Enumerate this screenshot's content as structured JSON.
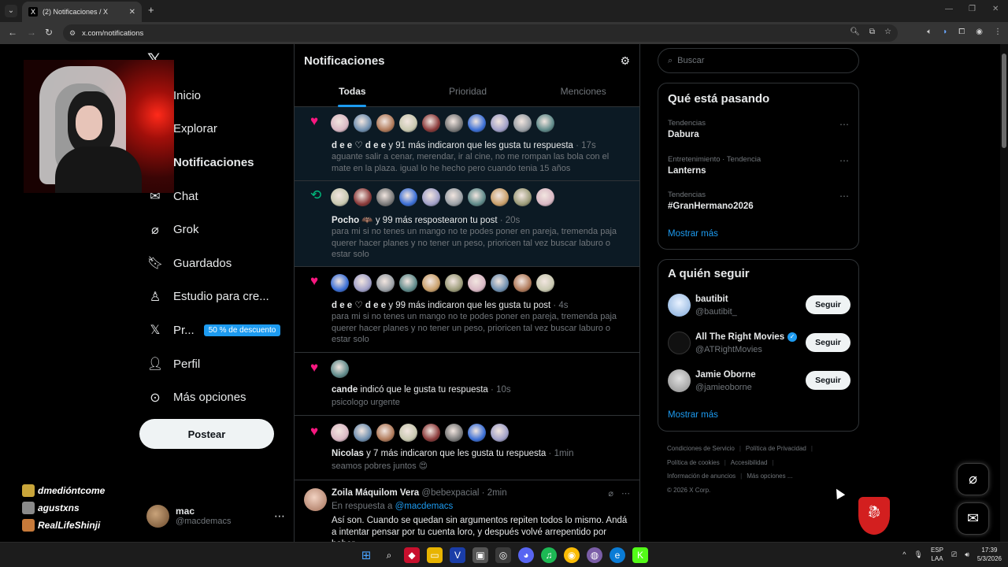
{
  "browser": {
    "tab_title": "(2) Notificaciones / X",
    "tab_favicon": "X",
    "url": "x.com/notifications"
  },
  "colors": {
    "accent": "#1d9bf0",
    "like": "#f91880",
    "retweet": "#00ba7c",
    "background": "#000000",
    "border": "#2f3336",
    "muted": "#71767b"
  },
  "nav": {
    "items": [
      {
        "label": "Inicio",
        "icon": "home-icon"
      },
      {
        "label": "Explorar",
        "icon": "search-icon"
      },
      {
        "label": "Notificaciones",
        "icon": "bell-icon"
      },
      {
        "label": "Chat",
        "icon": "mail-icon"
      },
      {
        "label": "Grok",
        "icon": "grok-icon"
      },
      {
        "label": "Guardados",
        "icon": "bookmark-icon"
      },
      {
        "label": "Estudio para cre...",
        "icon": "creator-studio-icon"
      },
      {
        "label": "Pr...",
        "icon": "x-logo-icon",
        "badge": "50 % de descuento"
      },
      {
        "label": "Perfil",
        "icon": "person-icon"
      },
      {
        "label": "Más opciones",
        "icon": "more-circle-icon"
      }
    ],
    "post_button": "Postear"
  },
  "account": {
    "name": "mac",
    "handle": "@macdemacs"
  },
  "viewers": [
    "dmedióntcome",
    "agustxns",
    "RealLifeShinji"
  ],
  "main": {
    "title": "Notificaciones",
    "tabs": [
      "Todas",
      "Prioridad",
      "Menciones"
    ],
    "active_tab": "Todas",
    "notifications": [
      {
        "kind": "like",
        "avatar_count": 10,
        "actor": "d e e ♡ d e e",
        "text": " y 91 más indicaron que les gusta tu respuesta",
        "time": " · 17s",
        "body": "aguante salir a cenar, merendar, ir al cine, no me rompan las bola con el mate en la plaza. igual lo he hecho pero cuando tenia 15 años",
        "highlighted": true
      },
      {
        "kind": "repost",
        "avatar_count": 10,
        "actor": "Pocho 🦇",
        "text": " y 99 más respostearon tu post",
        "time": " · 20s",
        "body": "para mi si no tenes un mango no te podes poner en pareja, tremenda paja querer hacer planes y no tener un peso, prioricen tal vez buscar laburo o estar solo",
        "highlighted": true
      },
      {
        "kind": "like",
        "avatar_count": 10,
        "actor": "d e e ♡ d e e",
        "text": " y 99 más indicaron que les gusta tu post",
        "time": " · 4s",
        "body": "para mi si no tenes un mango no te podes poner en pareja, tremenda paja querer hacer planes y no tener un peso, prioricen tal vez buscar laburo o estar solo",
        "highlighted": false
      },
      {
        "kind": "like",
        "avatar_count": 1,
        "actor": "cande",
        "text": " indicó que le gusta tu respuesta",
        "time": " · 10s",
        "body": "psicologo urgente",
        "highlighted": false
      },
      {
        "kind": "like",
        "avatar_count": 8,
        "actor": "Nicolas",
        "text": " y 7 más indicaron que les gusta tu respuesta",
        "time": " · 1min",
        "body": "seamos pobres juntos 😍",
        "highlighted": false
      }
    ],
    "reply_tweet": {
      "name": "Zoila Máquilom Vera",
      "handle": "@bebexpacial",
      "time": "· 2min",
      "reply_prefix": "En respuesta a ",
      "reply_to": "@macdemacs",
      "text": "Así son. Cuando se quedan sin argumentos repiten todos lo mismo. Andá a intentar pensar por tu cuenta loro, y después volvé arrepentido por haber"
    }
  },
  "sidebar": {
    "search_placeholder": "Buscar",
    "trends_title": "Qué está pasando",
    "trends": [
      {
        "context": "Tendencias",
        "name": "Dabura"
      },
      {
        "context": "Entretenimiento · Tendencia",
        "name": "Lanterns"
      },
      {
        "context": "Tendencias",
        "name": "#GranHermano2026"
      }
    ],
    "trends_more": "Mostrar más",
    "follow_title": "A quién seguir",
    "follow": [
      {
        "name": "bautibit",
        "handle": "@bautibit_",
        "verified": false,
        "button": "Seguir"
      },
      {
        "name": "All The Right Movies",
        "handle": "@ATRightMovies",
        "verified": true,
        "button": "Seguir"
      },
      {
        "name": "Jamie Oborne",
        "handle": "@jamieoborne",
        "verified": false,
        "button": "Seguir"
      }
    ],
    "follow_more": "Mostrar más",
    "footer": {
      "links": [
        "Condiciones de Servicio",
        "Política de Privacidad",
        "Política de cookies",
        "Accesibilidad",
        "Información de anuncios",
        "Más opciones ..."
      ],
      "copyright": "© 2026 X Corp."
    }
  },
  "taskbar": {
    "lang_top": "ESP",
    "lang_bottom": "LAA",
    "time": "17:39",
    "date": "5/3/2026"
  }
}
